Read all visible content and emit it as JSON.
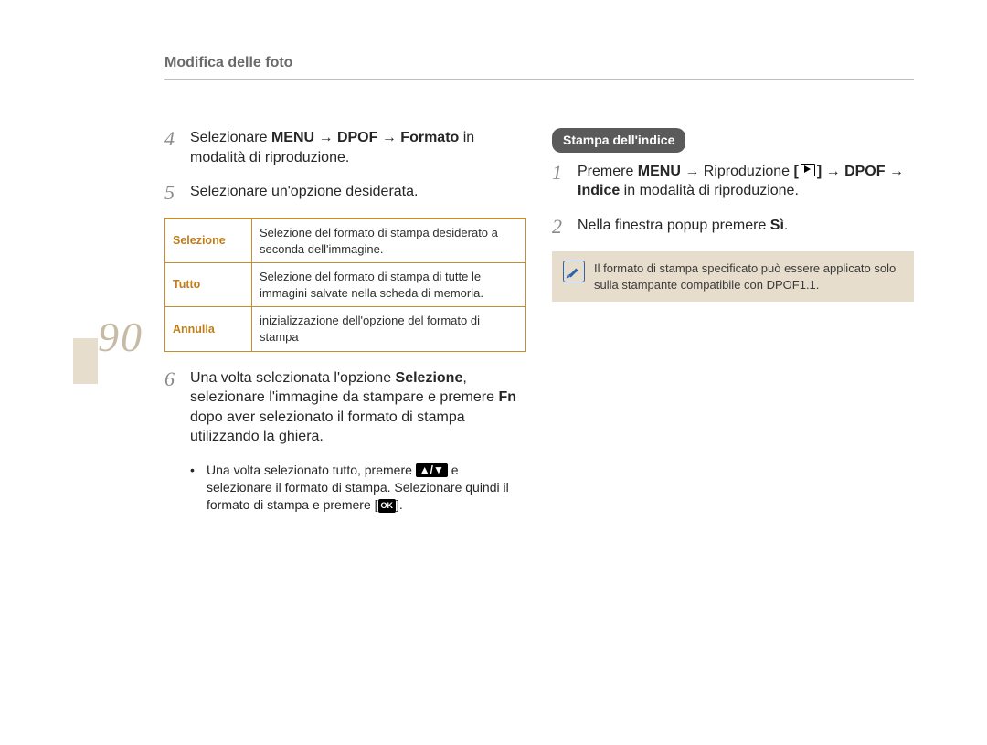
{
  "page_number": "90",
  "header": "Modifica delle foto",
  "left": {
    "step4": {
      "num": "4",
      "text_before": "Selezionare ",
      "b1": "MENU",
      "arrow1": " → ",
      "b2": "DPOF",
      "arrow2": " → ",
      "b3": "Formato",
      "text_after": " in modalità di riproduzione."
    },
    "step5": {
      "num": "5",
      "text": "Selezionare un'opzione desiderata."
    },
    "options": [
      {
        "name": "Selezione",
        "desc": "Selezione del formato di stampa desiderato a seconda dell'immagine."
      },
      {
        "name": "Tutto",
        "desc": "Selezione del formato di stampa di tutte le immagini salvate nella scheda di memoria."
      },
      {
        "name": "Annulla",
        "desc": "inizializzazione dell'opzione del formato di stampa"
      }
    ],
    "step6": {
      "num": "6",
      "l1_a": "Una volta selezionata l'opzione ",
      "l1_b": "Selezione",
      "l1_c": ", selezionare l'immagine da stampare e premere ",
      "l1_d": "Fn",
      "l1_e": " dopo aver selezionato il formato di stampa utilizzando la ghiera."
    },
    "bullet": {
      "a": "Una volta selezionato tutto, premere ",
      "chip": "▲/▼",
      "b": " e selezionare il formato di stampa. Selezionare quindi il formato di stampa e premere ",
      "okchip": "OK",
      "c": "."
    }
  },
  "right": {
    "pill": "Stampa dell'indice",
    "step1": {
      "num": "1",
      "a": "Premere ",
      "b1": "MENU",
      "c": " → Riproduzione ",
      "bracket_l": "[",
      "bracket_r": "]",
      "d": " → ",
      "b2": "DPOF",
      "e": " → ",
      "b3": "Indice",
      "f": " in modalità di riproduzione."
    },
    "step2": {
      "num": "2",
      "a": "Nella finestra popup premere ",
      "b": "Sì",
      "c": "."
    },
    "note": "Il formato di stampa specificato può essere applicato solo sulla stampante compatibile con DPOF1.1."
  }
}
